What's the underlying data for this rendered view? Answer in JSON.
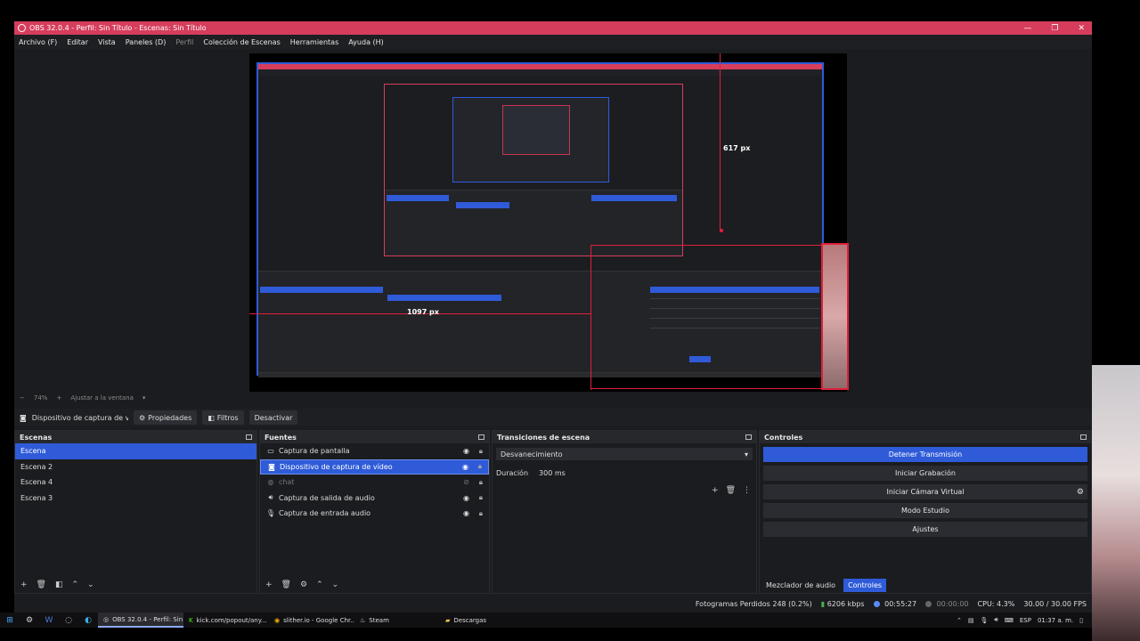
{
  "window": {
    "title": "OBS 32.0.4 - Perfil: Sin Título - Escenas: Sin Título",
    "controls": [
      "—",
      "❐",
      "✕"
    ]
  },
  "menu": [
    "Archivo (F)",
    "Editar",
    "Vista",
    "Paneles (D)",
    "Perfil",
    "Colección de Escenas",
    "Herramientas",
    "Ayuda (H)"
  ],
  "preview": {
    "measure_height": "617 px",
    "measure_width": "1097 px"
  },
  "zoom": {
    "minus": "−",
    "value": "74%",
    "plus": "+",
    "fit": "Ajustar a la ventana"
  },
  "source_toolbar": {
    "selected_source": "Dispositivo de captura de v",
    "properties": "Propiedades",
    "filters": "Filtros",
    "deactivate": "Desactivar"
  },
  "scenes": {
    "title": "Escenas",
    "items": [
      "Escena",
      "Escena 2",
      "Escena 4",
      "Escena 3"
    ]
  },
  "sources": {
    "title": "Fuentes",
    "items": [
      {
        "name": "Captura de pantalla",
        "icon": "monitor-icon"
      },
      {
        "name": "Dispositivo de captura de vídeo",
        "icon": "camera-icon"
      },
      {
        "name": "chat",
        "icon": "browser-icon"
      },
      {
        "name": "Captura de salida de audio",
        "icon": "speaker-icon"
      },
      {
        "name": "Captura de entrada audio",
        "icon": "mic-icon"
      }
    ]
  },
  "transitions": {
    "title": "Transiciones de escena",
    "selected": "Desvanecimiento",
    "duration_label": "Duración",
    "duration_value": "300 ms"
  },
  "controls": {
    "title": "Controles",
    "buttons": [
      "Detener Transmisión",
      "Iniciar Grabación",
      "Iniciar Cámara Virtual",
      "Modo Estudio",
      "Ajustes"
    ],
    "tabs": [
      "Mezclador de audio",
      "Controles"
    ]
  },
  "status": {
    "dropped": "Fotogramas Perdidos 248 (0.2%)",
    "bitrate": "6206 kbps",
    "stream_time": "00:55:27",
    "rec_time": "00:00:00",
    "cpu": "CPU: 4.3%",
    "fps": "30.00 / 30.00 FPS"
  },
  "taskbar": {
    "apps": [
      "OBS 32.0.4 - Perfil: Sin...",
      "kick.com/popout/any...",
      "slither.io - Google Chr...",
      "Steam",
      "Descargas"
    ],
    "lang": "ESP",
    "time": "01:37 a. m."
  },
  "colors": {
    "accent": "#2f5bd8",
    "titlebar": "#d63d5c"
  }
}
